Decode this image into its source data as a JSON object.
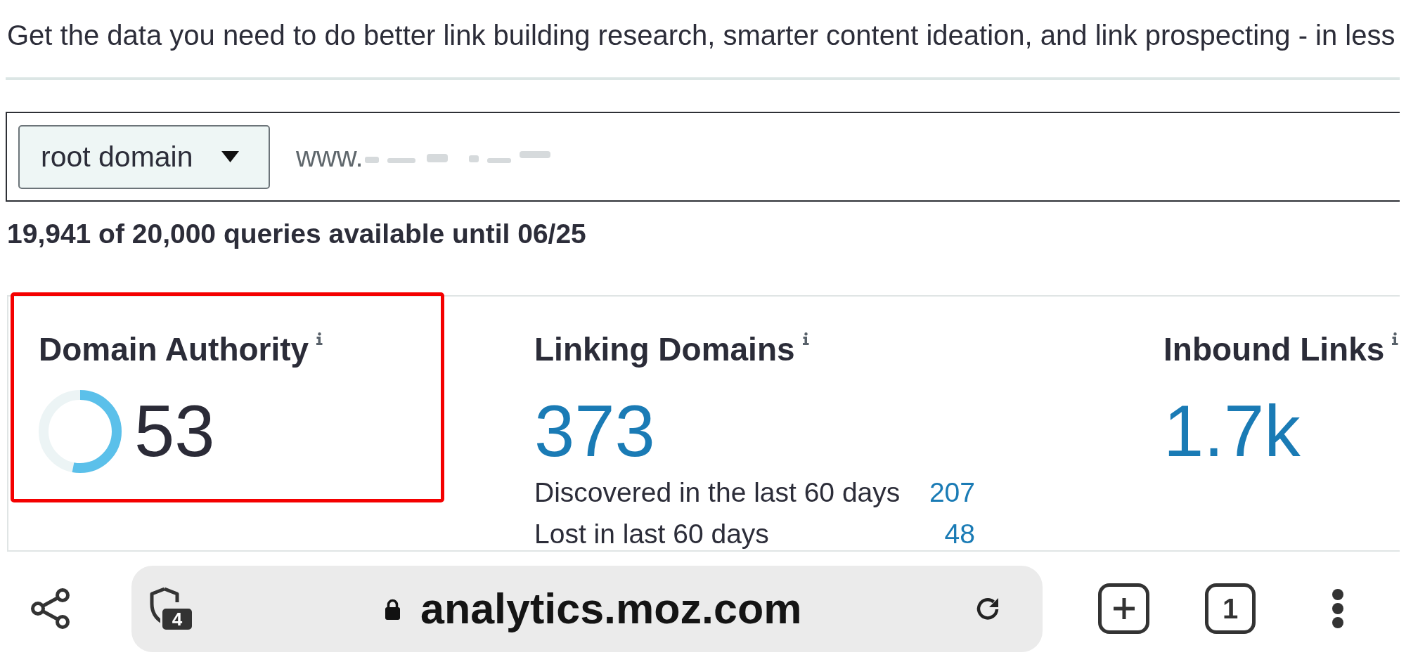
{
  "intro": {
    "text": "Get the data you need to do better link building research, smarter content ideation, and link prospecting - in less"
  },
  "search": {
    "scope": "root domain",
    "value": "www.",
    "redacted": true
  },
  "quota": {
    "text": "19,941 of 20,000 queries available until 06/25"
  },
  "metrics": [
    {
      "kind": "score",
      "title": "Domain Authority",
      "value": "53",
      "level": 0.53,
      "highlighted": true
    },
    {
      "kind": "count",
      "title": "Linking Domains",
      "value": "373",
      "highlighted": false,
      "details": [
        {
          "label": "Discovered in the last 60 days",
          "value": "207"
        },
        {
          "label": "Lost in last 60 days",
          "value": "48"
        }
      ]
    },
    {
      "kind": "count",
      "title": "Inbound Links",
      "value": "1.7k",
      "highlighted": false
    }
  ],
  "browser_bar": {
    "tracker_count": "4",
    "url": "analytics.moz.com",
    "tab_count": "1"
  }
}
